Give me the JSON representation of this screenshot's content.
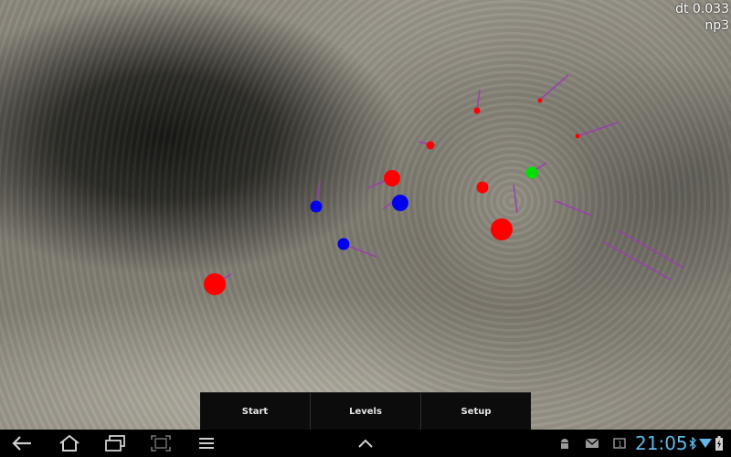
{
  "hud": {
    "dt": "dt 0.033",
    "np": "np3"
  },
  "buttons": {
    "start": "Start",
    "levels": "Levels",
    "setup": "Setup"
  },
  "status": {
    "time": "21:05"
  },
  "icons": {
    "back": "back-icon",
    "home": "home-icon",
    "recents": "recent-apps-icon",
    "screenshot": "screenshot-icon",
    "menu": "menu-icon",
    "up": "chevron-up-icon",
    "android": "android-debug-icon",
    "mail": "mail-icon",
    "notification": "notification-1-icon",
    "bluetooth": "bluetooth-icon",
    "wifi": "wifi-icon",
    "battery": "battery-charging-icon"
  },
  "colors": {
    "red": "#ff0000",
    "blue": "#0000ee",
    "green": "#00e000",
    "trail": "#9a3fb0",
    "clock": "#5fb8e8"
  }
}
